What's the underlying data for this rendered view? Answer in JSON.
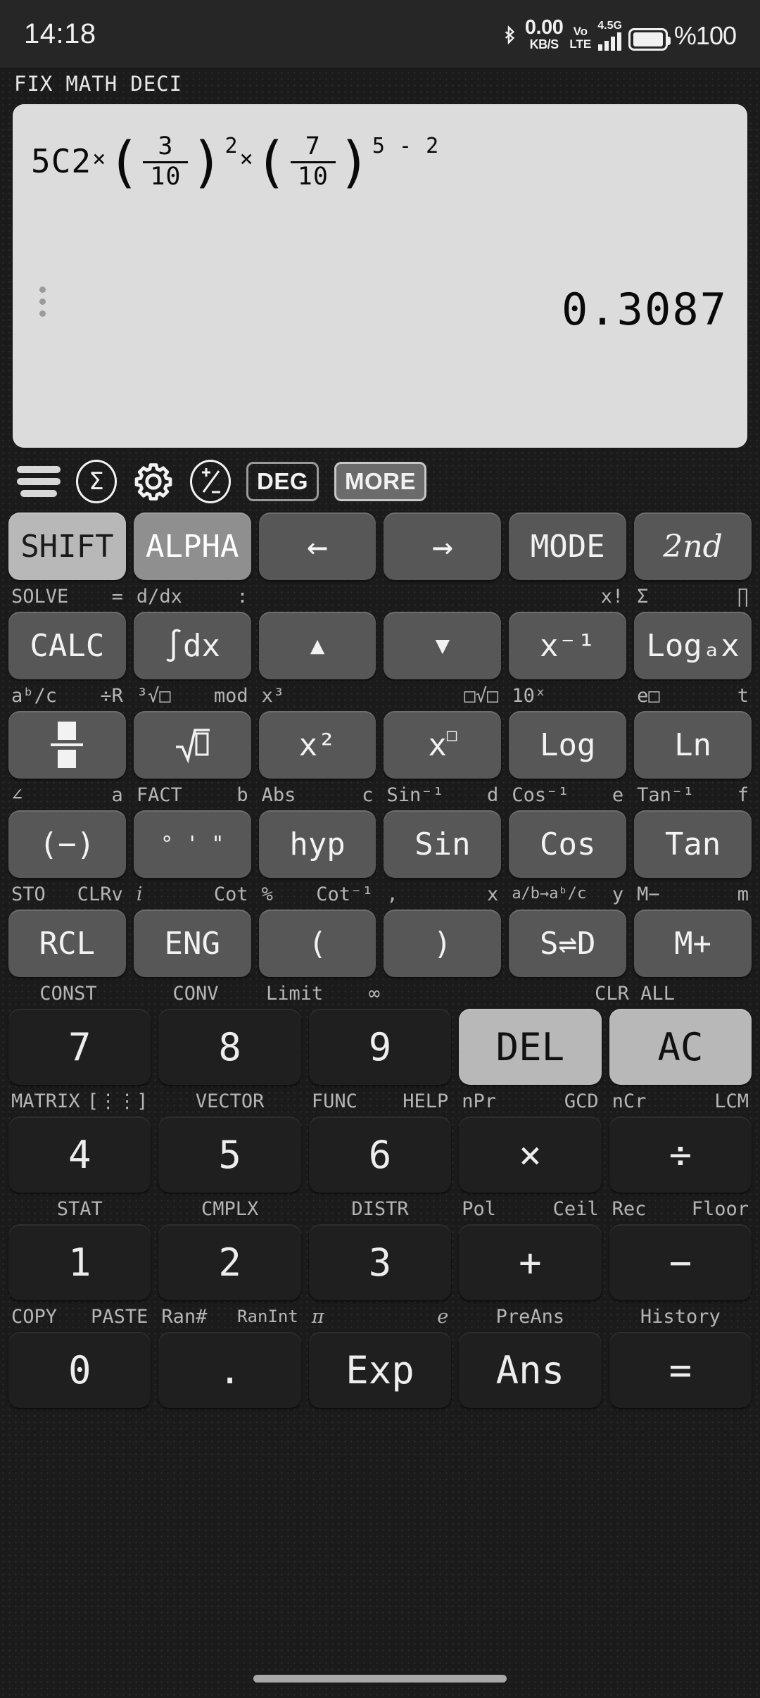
{
  "status_bar": {
    "time": "14:18",
    "bluetooth_icon": "bluetooth-icon",
    "net_speed_value": "0.00",
    "net_speed_unit": "KB/S",
    "volte_line1": "Vo",
    "volte_line2": "LTE",
    "network_gen": "4.5G",
    "battery_percent": "%100"
  },
  "mode_indicators": [
    "FIX",
    "MATH",
    "DECI"
  ],
  "display": {
    "expression": {
      "prefix": "5C2",
      "times1": "×",
      "open1": "(",
      "frac1_num": "3",
      "frac1_den": "10",
      "close1": ")",
      "exp1": "2",
      "times2": "×",
      "open2": "(",
      "frac2_num": "7",
      "frac2_den": "10",
      "close2": ")",
      "exp2": "5 - 2"
    },
    "expression_text": "5C2×(3/10)^2×(7/10)^(5-2)",
    "result": "0.3087",
    "overflow_menu": "vertical-dots"
  },
  "toolbar": {
    "menu_icon": "hamburger-menu-icon",
    "sigma_icon": "Σ",
    "gear_icon": "gear-icon",
    "plusminus_icon": "±",
    "angle_mode": "DEG",
    "more": "MORE"
  },
  "keypad": {
    "row1": {
      "keys": [
        {
          "label": "SHIFT",
          "style": "shift"
        },
        {
          "label": "ALPHA",
          "style": "alpha"
        },
        {
          "label": "←",
          "style": "func"
        },
        {
          "label": "→",
          "style": "func"
        },
        {
          "label": "MODE",
          "style": "func"
        },
        {
          "label": "2nd",
          "style": "func-italic"
        }
      ],
      "labels": [
        {
          "l": "SOLVE",
          "r": "="
        },
        {
          "l": "d/dx",
          "r": ":"
        },
        {
          "l": "",
          "r": ""
        },
        {
          "l": "",
          "r": ""
        },
        {
          "l": "",
          "r": "x!"
        },
        {
          "l": "Σ",
          "r": "∏"
        }
      ]
    },
    "row2": {
      "keys": [
        {
          "label": "CALC",
          "style": "func"
        },
        {
          "label": "∫dx",
          "style": "func"
        },
        {
          "label": "▲",
          "style": "func"
        },
        {
          "label": "▼",
          "style": "func"
        },
        {
          "label": "x⁻¹",
          "style": "func"
        },
        {
          "label": "Logₐx",
          "style": "func"
        }
      ],
      "labels": [
        {
          "l": "aᵇ/c",
          "r": "÷R"
        },
        {
          "l": "³√□",
          "r": "mod"
        },
        {
          "l": "x³",
          "r": ""
        },
        {
          "l": "",
          "r": "□√□"
        },
        {
          "l": "10ˣ",
          "r": ""
        },
        {
          "l": "e□",
          "r": "t"
        }
      ]
    },
    "row3": {
      "keys": [
        {
          "label": "fraction-icon",
          "style": "func"
        },
        {
          "label": "√□",
          "style": "func"
        },
        {
          "label": "x²",
          "style": "func"
        },
        {
          "label": "x□",
          "style": "func"
        },
        {
          "label": "Log",
          "style": "func"
        },
        {
          "label": "Ln",
          "style": "func"
        }
      ],
      "labels": [
        {
          "l": "∠",
          "r": "a"
        },
        {
          "l": "FACT",
          "r": "b"
        },
        {
          "l": "Abs",
          "r": "c"
        },
        {
          "l": "Sin⁻¹",
          "r": "d"
        },
        {
          "l": "Cos⁻¹",
          "r": "e"
        },
        {
          "l": "Tan⁻¹",
          "r": "f"
        }
      ]
    },
    "row4": {
      "keys": [
        {
          "label": "(−)",
          "style": "func"
        },
        {
          "label": "° ' \"",
          "style": "func"
        },
        {
          "label": "hyp",
          "style": "func"
        },
        {
          "label": "Sin",
          "style": "func"
        },
        {
          "label": "Cos",
          "style": "func"
        },
        {
          "label": "Tan",
          "style": "func"
        }
      ],
      "labels": [
        {
          "l": "STO",
          "r": "CLRv"
        },
        {
          "l": "i",
          "r": "Cot"
        },
        {
          "l": "%",
          "r": "Cot⁻¹"
        },
        {
          "l": ",",
          "r": "x"
        },
        {
          "l": "a/b→aᵇ/c",
          "r": "y"
        },
        {
          "l": "M−",
          "r": "m"
        }
      ]
    },
    "row5": {
      "keys": [
        {
          "label": "RCL",
          "style": "func"
        },
        {
          "label": "ENG",
          "style": "func"
        },
        {
          "label": "(",
          "style": "func"
        },
        {
          "label": ")",
          "style": "func"
        },
        {
          "label": "S⇌D",
          "style": "func"
        },
        {
          "label": "M+",
          "style": "func"
        }
      ],
      "labels": [
        {
          "l": "",
          "r": "CONST"
        },
        {
          "l": "",
          "r": "CONV"
        },
        {
          "l": "Limit",
          "r": "∞"
        },
        {
          "l": "",
          "r": ""
        },
        {
          "l": "",
          "r": "CLR"
        },
        {
          "l": "ALL",
          "r": ""
        }
      ]
    },
    "row6": {
      "keys": [
        {
          "label": "7",
          "style": "dark"
        },
        {
          "label": "8",
          "style": "dark"
        },
        {
          "label": "9",
          "style": "dark"
        },
        {
          "label": "DEL",
          "style": "light"
        },
        {
          "label": "AC",
          "style": "light"
        }
      ],
      "labels": [
        {
          "l": "MATRIX",
          "r": "[⋮⋮]"
        },
        {
          "l": "VECTOR",
          "r": ""
        },
        {
          "l": "FUNC",
          "r": "HELP"
        },
        {
          "l": "nPr",
          "r": "GCD"
        },
        {
          "l": "nCr",
          "r": "LCM"
        }
      ]
    },
    "row7": {
      "keys": [
        {
          "label": "4",
          "style": "dark"
        },
        {
          "label": "5",
          "style": "dark"
        },
        {
          "label": "6",
          "style": "dark"
        },
        {
          "label": "×",
          "style": "dark"
        },
        {
          "label": "÷",
          "style": "dark"
        }
      ],
      "labels": [
        {
          "l": "STAT",
          "r": ""
        },
        {
          "l": "CMPLX",
          "r": ""
        },
        {
          "l": "DISTR",
          "r": ""
        },
        {
          "l": "Pol",
          "r": "Ceil"
        },
        {
          "l": "Rec",
          "r": "Floor"
        }
      ]
    },
    "row8": {
      "keys": [
        {
          "label": "1",
          "style": "dark"
        },
        {
          "label": "2",
          "style": "dark"
        },
        {
          "label": "3",
          "style": "dark"
        },
        {
          "label": "+",
          "style": "dark"
        },
        {
          "label": "−",
          "style": "dark"
        }
      ],
      "labels": [
        {
          "l": "COPY",
          "r": "PASTE"
        },
        {
          "l": "Ran#",
          "r": "RanInt"
        },
        {
          "l": "π",
          "r": "e"
        },
        {
          "l": "",
          "r": "PreAns"
        },
        {
          "l": "History",
          "r": ""
        }
      ]
    },
    "row9": {
      "keys": [
        {
          "label": "0",
          "style": "dark"
        },
        {
          "label": ".",
          "style": "dark"
        },
        {
          "label": "Exp",
          "style": "dark"
        },
        {
          "label": "Ans",
          "style": "dark"
        },
        {
          "label": "=",
          "style": "dark"
        }
      ]
    },
    "row5_labels_above6": [
      {
        "l": "CONST",
        "r": ""
      },
      {
        "l": "CONV",
        "r": ""
      },
      {
        "l": "Limit",
        "r": "∞"
      },
      {
        "l": "",
        "r": ""
      },
      {
        "l": "CLR ALL",
        "r": ""
      }
    ]
  }
}
